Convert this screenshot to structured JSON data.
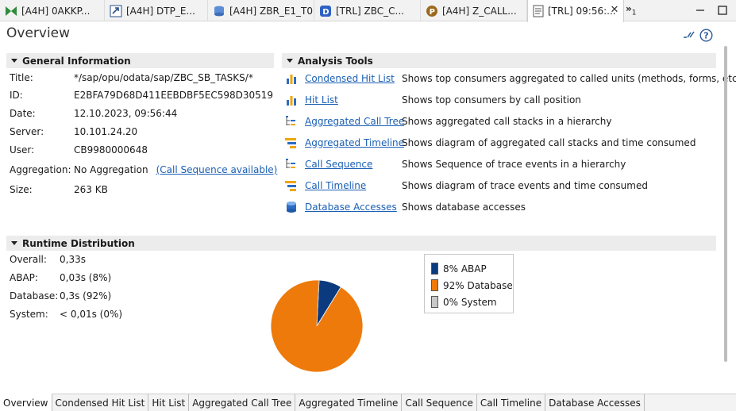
{
  "editor_tabs": [
    {
      "label": "[A4H] 0AKKP...",
      "icon": "bex-query-icon"
    },
    {
      "label": "[A4H] DTP_E...",
      "icon": "dtp-icon"
    },
    {
      "label": "[A4H] ZBR_E1_T0",
      "icon": "database-table-icon"
    },
    {
      "label": "[TRL] ZBC_C...",
      "icon": "cds-view-icon"
    },
    {
      "label": "[A4H] Z_CALL...",
      "icon": "program-icon"
    },
    {
      "label": "[TRL] 09:56:...",
      "icon": "trace-document-icon"
    }
  ],
  "tab_overflow": {
    "symbol": "»",
    "count": "1"
  },
  "page_title": "Overview",
  "general_info": {
    "title": "General Information",
    "rows": [
      {
        "label": "Title:",
        "value": "*/sap/opu/odata/sap/ZBC_SB_TASKS/*"
      },
      {
        "label": "ID:",
        "value": "E2BFA79D68D411EEBDBF5EC598D30519"
      },
      {
        "label": "Date:",
        "value": "12.10.2023, 09:56:44"
      },
      {
        "label": "Server:",
        "value": "10.101.24.20"
      },
      {
        "label": "User:",
        "value": "CB9980000648"
      },
      {
        "label": "Aggregation:",
        "value": "No Aggregation",
        "link": "(Call Sequence available)"
      },
      {
        "label": "Size:",
        "value": "263 KB"
      }
    ]
  },
  "analysis_tools": {
    "title": "Analysis Tools",
    "items": [
      {
        "name": "Condensed Hit List",
        "desc": "Shows top consumers aggregated to called units (methods, forms, etc.)",
        "icon": "bar-chart-icon"
      },
      {
        "name": "Hit List",
        "desc": "Shows top consumers by call position",
        "icon": "bar-chart-icon"
      },
      {
        "name": "Aggregated Call Tree",
        "desc": "Shows aggregated call stacks in a hierarchy",
        "icon": "tree-icon"
      },
      {
        "name": "Aggregated Timeline",
        "desc": "Shows diagram of aggregated call stacks and time consumed",
        "icon": "timeline-icon"
      },
      {
        "name": "Call Sequence",
        "desc": "Shows Sequence of trace events in a hierarchy",
        "icon": "tree-icon"
      },
      {
        "name": "Call Timeline",
        "desc": "Shows diagram of trace events and time consumed",
        "icon": "timeline-icon"
      },
      {
        "name": "Database Accesses",
        "desc": "Shows database accesses",
        "icon": "database-icon"
      }
    ]
  },
  "runtime_distribution": {
    "title": "Runtime Distribution",
    "rows": [
      {
        "label": "Overall:",
        "value": "0,33s"
      },
      {
        "label": "ABAP:",
        "value": "0,03s (8%)"
      },
      {
        "label": "Database:",
        "value": "0,3s (92%)"
      },
      {
        "label": "System:",
        "value": "< 0,01s (0%)"
      }
    ]
  },
  "chart_data": {
    "type": "pie",
    "categories": [
      "ABAP",
      "Database",
      "System"
    ],
    "values": [
      8,
      92,
      0
    ],
    "legend": [
      "8% ABAP",
      "92% Database",
      "0% System"
    ],
    "colors": [
      "#0b3a7e",
      "#ed7a0a",
      "#c8c8c8"
    ],
    "legend_position": "right"
  },
  "bottom_tabs": [
    "Overview",
    "Condensed Hit List",
    "Hit List",
    "Aggregated Call Tree",
    "Aggregated Timeline",
    "Call Sequence",
    "Call Timeline",
    "Database Accesses"
  ],
  "colors": {
    "link": "#1a5fb4",
    "section_bg": "#ececec",
    "abap": "#0b3a7e",
    "database": "#ed7a0a",
    "system": "#c8c8c8"
  }
}
